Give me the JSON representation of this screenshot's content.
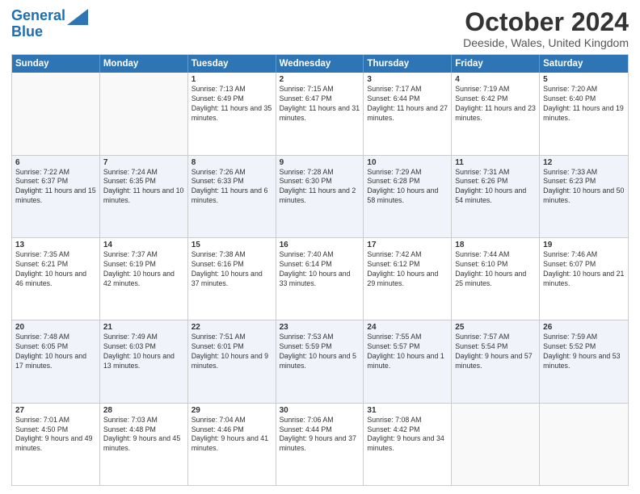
{
  "logo": {
    "line1": "General",
    "line2": "Blue"
  },
  "header": {
    "month": "October 2024",
    "location": "Deeside, Wales, United Kingdom"
  },
  "days": [
    "Sunday",
    "Monday",
    "Tuesday",
    "Wednesday",
    "Thursday",
    "Friday",
    "Saturday"
  ],
  "weeks": [
    [
      {
        "day": "",
        "sunrise": "",
        "sunset": "",
        "daylight": ""
      },
      {
        "day": "",
        "sunrise": "",
        "sunset": "",
        "daylight": ""
      },
      {
        "day": "1",
        "sunrise": "Sunrise: 7:13 AM",
        "sunset": "Sunset: 6:49 PM",
        "daylight": "Daylight: 11 hours and 35 minutes."
      },
      {
        "day": "2",
        "sunrise": "Sunrise: 7:15 AM",
        "sunset": "Sunset: 6:47 PM",
        "daylight": "Daylight: 11 hours and 31 minutes."
      },
      {
        "day": "3",
        "sunrise": "Sunrise: 7:17 AM",
        "sunset": "Sunset: 6:44 PM",
        "daylight": "Daylight: 11 hours and 27 minutes."
      },
      {
        "day": "4",
        "sunrise": "Sunrise: 7:19 AM",
        "sunset": "Sunset: 6:42 PM",
        "daylight": "Daylight: 11 hours and 23 minutes."
      },
      {
        "day": "5",
        "sunrise": "Sunrise: 7:20 AM",
        "sunset": "Sunset: 6:40 PM",
        "daylight": "Daylight: 11 hours and 19 minutes."
      }
    ],
    [
      {
        "day": "6",
        "sunrise": "Sunrise: 7:22 AM",
        "sunset": "Sunset: 6:37 PM",
        "daylight": "Daylight: 11 hours and 15 minutes."
      },
      {
        "day": "7",
        "sunrise": "Sunrise: 7:24 AM",
        "sunset": "Sunset: 6:35 PM",
        "daylight": "Daylight: 11 hours and 10 minutes."
      },
      {
        "day": "8",
        "sunrise": "Sunrise: 7:26 AM",
        "sunset": "Sunset: 6:33 PM",
        "daylight": "Daylight: 11 hours and 6 minutes."
      },
      {
        "day": "9",
        "sunrise": "Sunrise: 7:28 AM",
        "sunset": "Sunset: 6:30 PM",
        "daylight": "Daylight: 11 hours and 2 minutes."
      },
      {
        "day": "10",
        "sunrise": "Sunrise: 7:29 AM",
        "sunset": "Sunset: 6:28 PM",
        "daylight": "Daylight: 10 hours and 58 minutes."
      },
      {
        "day": "11",
        "sunrise": "Sunrise: 7:31 AM",
        "sunset": "Sunset: 6:26 PM",
        "daylight": "Daylight: 10 hours and 54 minutes."
      },
      {
        "day": "12",
        "sunrise": "Sunrise: 7:33 AM",
        "sunset": "Sunset: 6:23 PM",
        "daylight": "Daylight: 10 hours and 50 minutes."
      }
    ],
    [
      {
        "day": "13",
        "sunrise": "Sunrise: 7:35 AM",
        "sunset": "Sunset: 6:21 PM",
        "daylight": "Daylight: 10 hours and 46 minutes."
      },
      {
        "day": "14",
        "sunrise": "Sunrise: 7:37 AM",
        "sunset": "Sunset: 6:19 PM",
        "daylight": "Daylight: 10 hours and 42 minutes."
      },
      {
        "day": "15",
        "sunrise": "Sunrise: 7:38 AM",
        "sunset": "Sunset: 6:16 PM",
        "daylight": "Daylight: 10 hours and 37 minutes."
      },
      {
        "day": "16",
        "sunrise": "Sunrise: 7:40 AM",
        "sunset": "Sunset: 6:14 PM",
        "daylight": "Daylight: 10 hours and 33 minutes."
      },
      {
        "day": "17",
        "sunrise": "Sunrise: 7:42 AM",
        "sunset": "Sunset: 6:12 PM",
        "daylight": "Daylight: 10 hours and 29 minutes."
      },
      {
        "day": "18",
        "sunrise": "Sunrise: 7:44 AM",
        "sunset": "Sunset: 6:10 PM",
        "daylight": "Daylight: 10 hours and 25 minutes."
      },
      {
        "day": "19",
        "sunrise": "Sunrise: 7:46 AM",
        "sunset": "Sunset: 6:07 PM",
        "daylight": "Daylight: 10 hours and 21 minutes."
      }
    ],
    [
      {
        "day": "20",
        "sunrise": "Sunrise: 7:48 AM",
        "sunset": "Sunset: 6:05 PM",
        "daylight": "Daylight: 10 hours and 17 minutes."
      },
      {
        "day": "21",
        "sunrise": "Sunrise: 7:49 AM",
        "sunset": "Sunset: 6:03 PM",
        "daylight": "Daylight: 10 hours and 13 minutes."
      },
      {
        "day": "22",
        "sunrise": "Sunrise: 7:51 AM",
        "sunset": "Sunset: 6:01 PM",
        "daylight": "Daylight: 10 hours and 9 minutes."
      },
      {
        "day": "23",
        "sunrise": "Sunrise: 7:53 AM",
        "sunset": "Sunset: 5:59 PM",
        "daylight": "Daylight: 10 hours and 5 minutes."
      },
      {
        "day": "24",
        "sunrise": "Sunrise: 7:55 AM",
        "sunset": "Sunset: 5:57 PM",
        "daylight": "Daylight: 10 hours and 1 minute."
      },
      {
        "day": "25",
        "sunrise": "Sunrise: 7:57 AM",
        "sunset": "Sunset: 5:54 PM",
        "daylight": "Daylight: 9 hours and 57 minutes."
      },
      {
        "day": "26",
        "sunrise": "Sunrise: 7:59 AM",
        "sunset": "Sunset: 5:52 PM",
        "daylight": "Daylight: 9 hours and 53 minutes."
      }
    ],
    [
      {
        "day": "27",
        "sunrise": "Sunrise: 7:01 AM",
        "sunset": "Sunset: 4:50 PM",
        "daylight": "Daylight: 9 hours and 49 minutes."
      },
      {
        "day": "28",
        "sunrise": "Sunrise: 7:03 AM",
        "sunset": "Sunset: 4:48 PM",
        "daylight": "Daylight: 9 hours and 45 minutes."
      },
      {
        "day": "29",
        "sunrise": "Sunrise: 7:04 AM",
        "sunset": "Sunset: 4:46 PM",
        "daylight": "Daylight: 9 hours and 41 minutes."
      },
      {
        "day": "30",
        "sunrise": "Sunrise: 7:06 AM",
        "sunset": "Sunset: 4:44 PM",
        "daylight": "Daylight: 9 hours and 37 minutes."
      },
      {
        "day": "31",
        "sunrise": "Sunrise: 7:08 AM",
        "sunset": "Sunset: 4:42 PM",
        "daylight": "Daylight: 9 hours and 34 minutes."
      },
      {
        "day": "",
        "sunrise": "",
        "sunset": "",
        "daylight": ""
      },
      {
        "day": "",
        "sunrise": "",
        "sunset": "",
        "daylight": ""
      }
    ]
  ]
}
